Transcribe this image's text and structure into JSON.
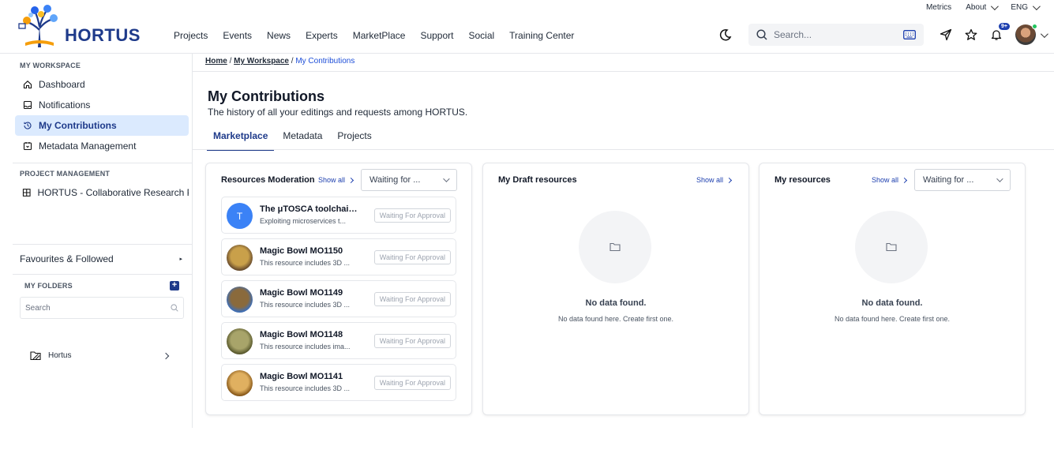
{
  "utility": {
    "metrics": "Metrics",
    "about": "About",
    "lang": "ENG"
  },
  "brand": {
    "name": "HORTUS"
  },
  "nav": [
    "Projects",
    "Events",
    "News",
    "Experts",
    "MarketPlace",
    "Support",
    "Social",
    "Training Center"
  ],
  "header": {
    "search_placeholder": "Search...",
    "notification_badge": "9+"
  },
  "sidebar": {
    "workspace_title": "MY WORKSPACE",
    "items": [
      {
        "label": "Dashboard",
        "icon": "home-icon"
      },
      {
        "label": "Notifications",
        "icon": "inbox-icon"
      },
      {
        "label": "My Contributions",
        "icon": "history-icon",
        "active": true
      },
      {
        "label": "Metadata Management",
        "icon": "metadata-icon"
      }
    ],
    "project_title": "PROJECT MANAGEMENT",
    "project_item": "HORTUS - Collaborative Research Pl",
    "favourites": "Favourites & Followed",
    "folders_title": "MY FOLDERS",
    "folder_search_placeholder": "Search",
    "folder": "Hortus"
  },
  "breadcrumb": {
    "home": "Home",
    "workspace": "My Workspace",
    "current": "My Contributions",
    "sep": "/"
  },
  "page": {
    "title": "My Contributions",
    "subtitle": "The history of all your editings and requests among HORTUS."
  },
  "tabs": [
    "Marketplace",
    "Metadata",
    "Projects"
  ],
  "moderation": {
    "title": "Resources Moderation",
    "show_all": "Show all",
    "filter": "Waiting for ...",
    "items": [
      {
        "title": "The μTOSCA toolchain...",
        "desc": "Exploiting microservices t...",
        "status": "Waiting For Approval",
        "thumb": "T"
      },
      {
        "title": "Magic Bowl MO1150",
        "desc": "This resource includes 3D ...",
        "status": "Waiting For Approval",
        "colors": [
          "#6b4e2e",
          "#c9a04a"
        ]
      },
      {
        "title": "Magic Bowl MO1149",
        "desc": "This resource includes 3D ...",
        "status": "Waiting For Approval",
        "colors": [
          "#3e6fb8",
          "#8a6a3c"
        ]
      },
      {
        "title": "Magic Bowl MO1148",
        "desc": "This resource includes ima...",
        "status": "Waiting For Approval",
        "colors": [
          "#5a5a2e",
          "#a8a46a"
        ]
      },
      {
        "title": "Magic Bowl MO1141",
        "desc": "This resource includes 3D ...",
        "status": "Waiting For Approval",
        "colors": [
          "#8a5a1a",
          "#e0b060"
        ]
      }
    ]
  },
  "drafts": {
    "title": "My Draft resources",
    "show_all": "Show all",
    "empty_title": "No data found.",
    "empty_sub": "No data found here. Create first one."
  },
  "resources": {
    "title": "My resources",
    "show_all": "Show all",
    "filter": "Waiting for ...",
    "empty_title": "No data found.",
    "empty_sub": "No data found here. Create first one."
  }
}
